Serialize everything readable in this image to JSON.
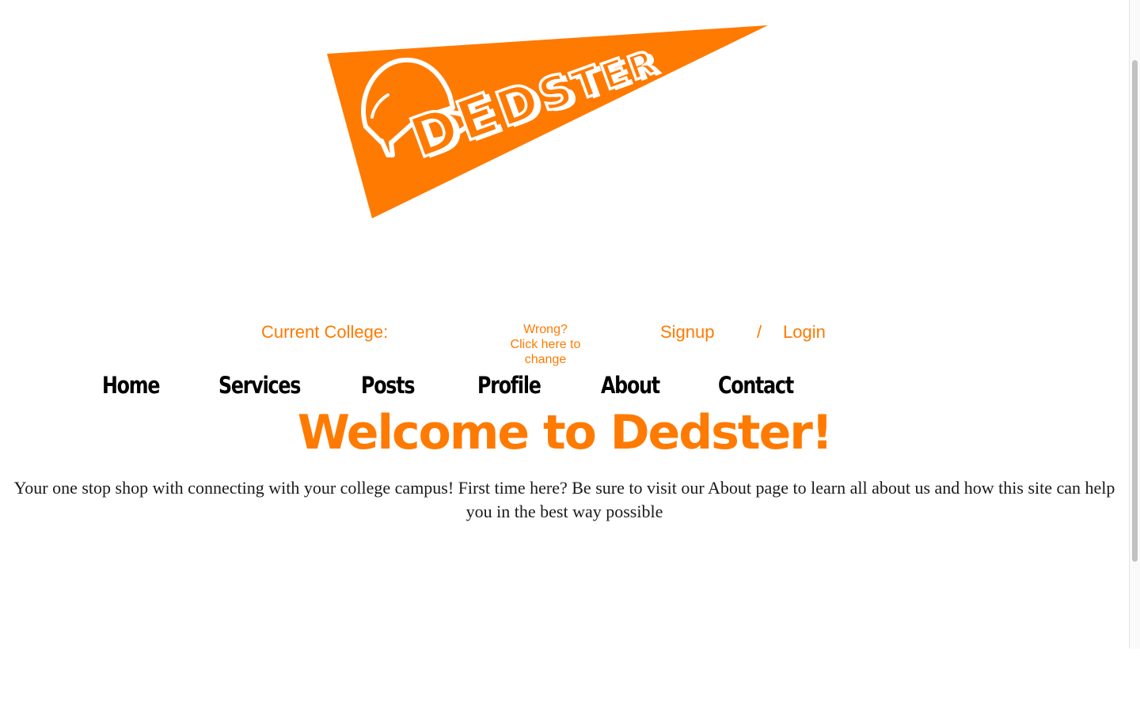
{
  "brand": {
    "logo_text": "DEDSTER",
    "accent_color": "#ff7a00"
  },
  "college_bar": {
    "label": "Current College:",
    "change_link_line1": "Wrong?",
    "change_link_line2": "Click here to",
    "change_link_line3": "change",
    "signup": "Signup",
    "separator": "/",
    "login": "Login"
  },
  "nav": {
    "items": [
      {
        "label": "Home"
      },
      {
        "label": "Services"
      },
      {
        "label": "Posts"
      },
      {
        "label": "Profile"
      },
      {
        "label": "About"
      },
      {
        "label": "Contact"
      }
    ]
  },
  "main": {
    "heading": "Welcome to Dedster!",
    "intro": "Your one stop shop with connecting with your college campus! First time here? Be sure to visit our About page to learn all about us and how this site can help you in the best way possible"
  },
  "icons": {
    "logo_icon": "baseball-cap-icon"
  }
}
